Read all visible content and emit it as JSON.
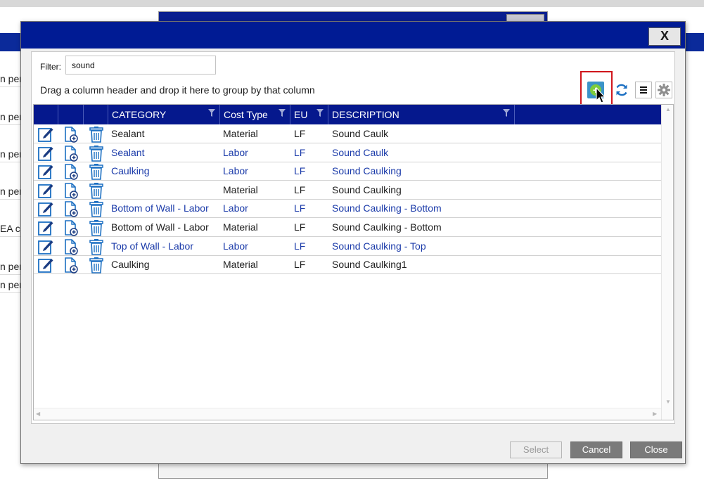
{
  "background": {
    "row_fragments": [
      "n per",
      "n per",
      "n per",
      "n per",
      "EA c",
      "n per",
      "n per"
    ]
  },
  "dialog": {
    "close_glyph": "X",
    "filter": {
      "label": "Filter:",
      "value": "sound"
    },
    "group_hint": "Drag a column header and drop it here to group by that column",
    "toolbar": {
      "add_icon": "plus-circle-icon",
      "refresh_icon": "refresh-icon",
      "menu_icon": "menu-icon",
      "settings_icon": "gear-icon"
    },
    "columns": [
      "CATEGORY",
      "Cost Type",
      "EU",
      "DESCRIPTION"
    ],
    "rows": [
      {
        "category": "Sealant",
        "cost_type": "Material",
        "eu": "LF",
        "description": "Sound Caulk",
        "style": "black"
      },
      {
        "category": "Sealant",
        "cost_type": "Labor",
        "eu": "LF",
        "description": "Sound Caulk",
        "style": "blue"
      },
      {
        "category": "Caulking",
        "cost_type": "Labor",
        "eu": "LF",
        "description": "Sound Caulking",
        "style": "blue"
      },
      {
        "category": "",
        "cost_type": "Material",
        "eu": "LF",
        "description": "Sound Caulking",
        "style": "black"
      },
      {
        "category": "Bottom of Wall - Labor",
        "cost_type": "Labor",
        "eu": "LF",
        "description": "Sound Caulking - Bottom",
        "style": "blue"
      },
      {
        "category": "Bottom of Wall - Labor",
        "cost_type": "Material",
        "eu": "LF",
        "description": "Sound Caulking - Bottom",
        "style": "black"
      },
      {
        "category": "Top of Wall - Labor",
        "cost_type": "Labor",
        "eu": "LF",
        "description": "Sound Caulking - Top",
        "style": "blue"
      },
      {
        "category": "Caulking",
        "cost_type": "Material",
        "eu": "LF",
        "description": "Sound Caulking1",
        "style": "black"
      }
    ],
    "buttons": {
      "select": "Select",
      "cancel": "Cancel",
      "close": "Close"
    }
  }
}
